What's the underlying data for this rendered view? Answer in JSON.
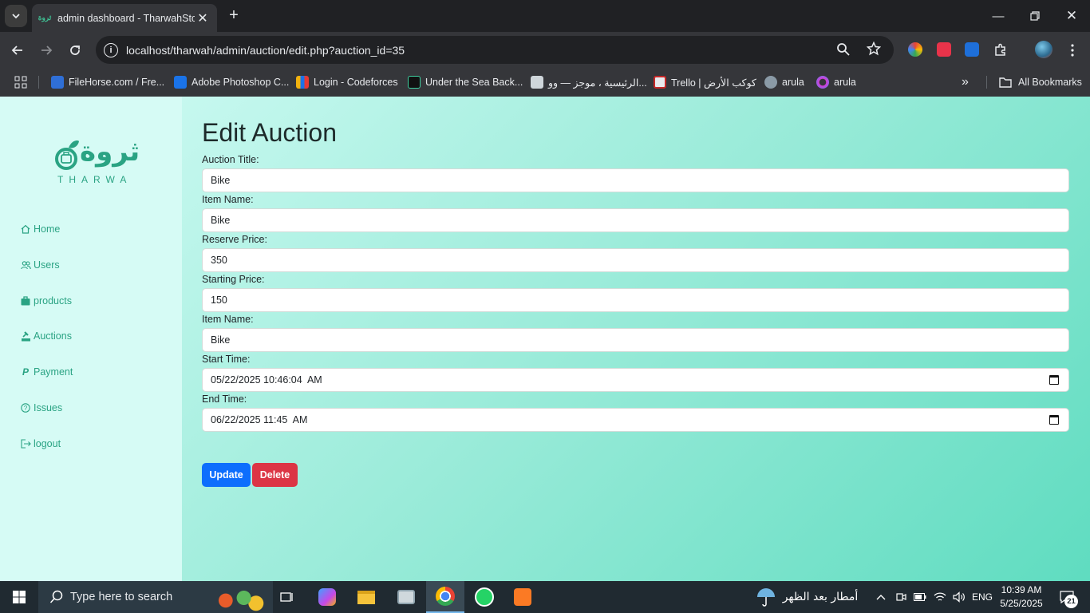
{
  "browser": {
    "tab_title": "admin dashboard - TharwahStore",
    "tab_favicon_text": "ثروة",
    "url": "localhost/tharwah/admin/auction/edit.php?auction_id=35",
    "bookmarks": [
      {
        "label": "FileHorse.com / Fre...",
        "color": "#2f6fd6"
      },
      {
        "label": "Adobe Photoshop C...",
        "color": "#1a73e8"
      },
      {
        "label": "Login - Codeforces",
        "color": "#f2b20f"
      },
      {
        "label": "Under the Sea Back...",
        "color": "#111111"
      },
      {
        "label": "الرئيسية ، موجز — وو...",
        "color": "#cfd6da"
      },
      {
        "label": "Trello | كوكب الأرض",
        "color": "#e8eaed"
      },
      {
        "label": "arula",
        "color": "#8a9aa6"
      },
      {
        "label": "arula",
        "color": "#d63bd6"
      }
    ],
    "all_bookmarks_label": "All Bookmarks"
  },
  "sidebar": {
    "logo_text_ar": "ثروة",
    "logo_text_en": "THARWA",
    "items": [
      {
        "label": "Home",
        "icon": "home-icon"
      },
      {
        "label": "Users",
        "icon": "users-icon"
      },
      {
        "label": "products",
        "icon": "briefcase-icon"
      },
      {
        "label": "Auctions",
        "icon": "auction-icon"
      },
      {
        "label": "Payment",
        "icon": "paypal-icon"
      },
      {
        "label": "Issues",
        "icon": "question-icon"
      },
      {
        "label": "logout",
        "icon": "logout-icon"
      }
    ]
  },
  "form": {
    "title": "Edit Auction",
    "fields": [
      {
        "label": "Auction Title:",
        "value": "Bike"
      },
      {
        "label": "Item Name:",
        "value": "Bike"
      },
      {
        "label": "Reserve Price:",
        "value": "350"
      },
      {
        "label": "Starting Price:",
        "value": "150"
      },
      {
        "label": "Item Name:",
        "value": "Bike"
      },
      {
        "label": "Start Time:",
        "value": "05/22/2025 10:46:04  AM"
      },
      {
        "label": "End Time:",
        "value": "06/22/2025 11:45  AM"
      }
    ],
    "update_label": "Update",
    "delete_label": "Delete"
  },
  "colors": {
    "accent": "#2aa383",
    "update_button": "#0d6efd",
    "delete_button": "#dc3545"
  },
  "taskbar": {
    "search_placeholder": "Type here to search",
    "weather_text": "أمطار بعد الظهر",
    "language": "ENG",
    "time": "10:39 AM",
    "date": "5/25/2025",
    "notification_count": "21"
  }
}
